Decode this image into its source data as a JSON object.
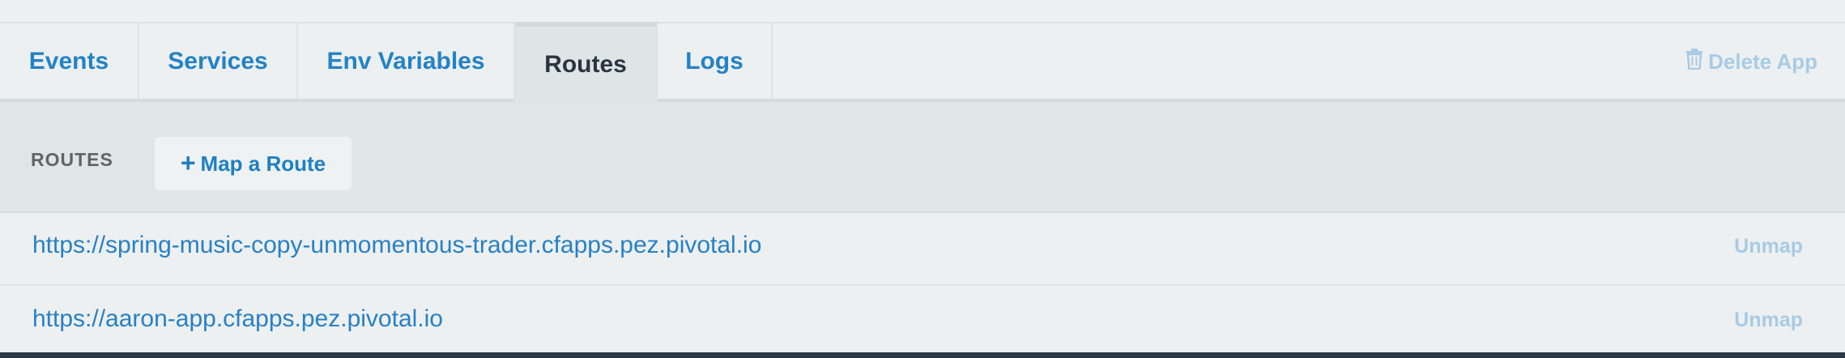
{
  "tabs": [
    {
      "label": "Events",
      "active": false
    },
    {
      "label": "Services",
      "active": false
    },
    {
      "label": "Env Variables",
      "active": false
    },
    {
      "label": "Routes",
      "active": true
    },
    {
      "label": "Logs",
      "active": false
    }
  ],
  "delete_app": {
    "label": "Delete App",
    "icon": "trash-icon",
    "color": "#a9cbe4"
  },
  "routes_section": {
    "label": "ROUTES",
    "map_button": {
      "icon": "plus-icon",
      "label": "Map a Route"
    }
  },
  "routes": [
    {
      "url": "https://spring-music-copy-unmomentous-trader.cfapps.pez.pivotal.io",
      "action": "Unmap"
    },
    {
      "url": "https://aaron-app.cfapps.pez.pivotal.io",
      "action": "Unmap"
    }
  ],
  "colors": {
    "link": "#2482c5",
    "active_tab_text": "#2a3540",
    "muted_action": "#a9cbe4",
    "background": "#ecf0f1",
    "header_band": "#e0e5e7"
  }
}
